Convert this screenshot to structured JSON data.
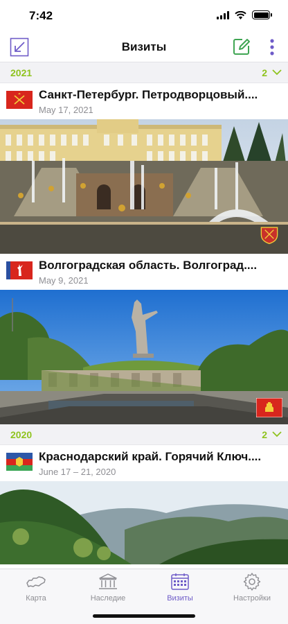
{
  "status_bar": {
    "time": "7:42"
  },
  "nav": {
    "title": "Визиты"
  },
  "colors": {
    "accent_green": "#8fc31f",
    "accent_purple": "#6e5bc8",
    "inactive": "#8e8e93"
  },
  "sections": [
    {
      "year": "2021",
      "count": "2",
      "visits": [
        {
          "title": "Санкт-Петербург. Петродворцовый....",
          "date": "May 17, 2021"
        },
        {
          "title": "Волгоградская область. Волгоград....",
          "date": "May 9, 2021"
        }
      ]
    },
    {
      "year": "2020",
      "count": "2",
      "visits": [
        {
          "title": "Краснодарский край. Горячий Ключ....",
          "date": "June 17 – 21, 2020"
        }
      ]
    }
  ],
  "tabs": [
    {
      "label": "Карта",
      "icon": "russia-map-icon",
      "active": false
    },
    {
      "label": "Наследие",
      "icon": "museum-icon",
      "active": false
    },
    {
      "label": "Визиты",
      "icon": "calendar-icon",
      "active": true
    },
    {
      "label": "Настройки",
      "icon": "gear-icon",
      "active": false
    }
  ]
}
